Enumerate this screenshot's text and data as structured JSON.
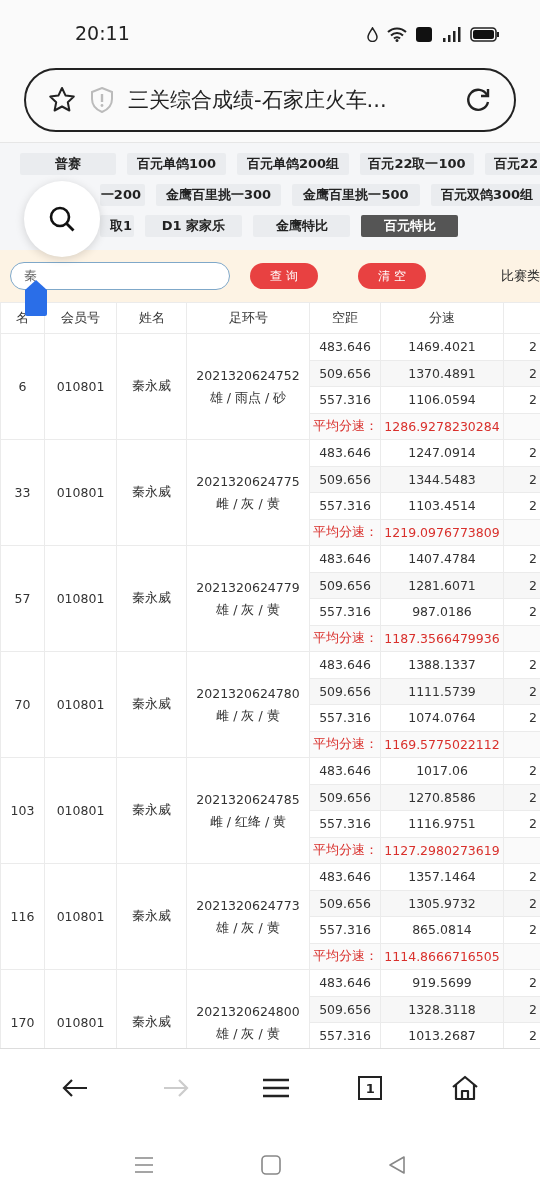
{
  "status_bar": {
    "time": "20:11"
  },
  "address_bar": {
    "title": "三关综合成绩-石家庄火车..."
  },
  "race_filters": {
    "rows": [
      [
        {
          "label": "普赛",
          "selected": false
        },
        {
          "label": "百元单鸽100",
          "selected": false
        },
        {
          "label": "百元单鸽200组",
          "selected": false
        },
        {
          "label": "百元22取一100",
          "selected": false
        },
        {
          "label": "百元22",
          "selected": false
        }
      ],
      [
        {
          "label": "一200",
          "selected": false
        },
        {
          "label": "金鹰百里挑一300",
          "selected": false
        },
        {
          "label": "金鹰百里挑一500",
          "selected": false
        },
        {
          "label": "百元双鸽300组",
          "selected": false
        }
      ],
      [
        {
          "label": "取1",
          "selected": false
        },
        {
          "label": "D1 家家乐",
          "selected": false
        },
        {
          "label": "金鹰特比",
          "selected": false
        },
        {
          "label": "百元特比",
          "selected": true
        }
      ]
    ]
  },
  "search": {
    "value": "秦",
    "buttons": [
      "查 询",
      "清 空"
    ],
    "type_label": "比赛类"
  },
  "table": {
    "columns": [
      "名",
      "会员号",
      "姓名",
      "足环号",
      "空距",
      "分速"
    ],
    "groups": [
      {
        "rank": "6",
        "member_id": "010801",
        "name": "秦永威",
        "ring": "2021320624752",
        "description": "雄 / 雨点 / 砂",
        "legs": [
          {
            "distance": "483.646",
            "speed": "1469.4021",
            "column_7": "2"
          },
          {
            "distance": "509.656",
            "speed": "1370.4891",
            "column_7": "2"
          },
          {
            "distance": "557.316",
            "speed": "1106.0594",
            "column_7": "2"
          }
        ],
        "average": {
          "label": "平均分速：",
          "value": "1286.9278230284"
        }
      },
      {
        "rank": "33",
        "member_id": "010801",
        "name": "秦永威",
        "ring": "2021320624775",
        "description": "雌 / 灰 / 黄",
        "legs": [
          {
            "distance": "483.646",
            "speed": "1247.0914",
            "column_7": "2"
          },
          {
            "distance": "509.656",
            "speed": "1344.5483",
            "column_7": "2"
          },
          {
            "distance": "557.316",
            "speed": "1103.4514",
            "column_7": "2"
          }
        ],
        "average": {
          "label": "平均分速：",
          "value": "1219.0976773809"
        }
      },
      {
        "rank": "57",
        "member_id": "010801",
        "name": "秦永威",
        "ring": "2021320624779",
        "description": "雄 / 灰 / 黄",
        "legs": [
          {
            "distance": "483.646",
            "speed": "1407.4784",
            "column_7": "2"
          },
          {
            "distance": "509.656",
            "speed": "1281.6071",
            "column_7": "2"
          },
          {
            "distance": "557.316",
            "speed": "987.0186",
            "column_7": "2"
          }
        ],
        "average": {
          "label": "平均分速：",
          "value": "1187.3566479936"
        }
      },
      {
        "rank": "70",
        "member_id": "010801",
        "name": "秦永威",
        "ring": "2021320624780",
        "description": "雌 / 灰 / 黄",
        "legs": [
          {
            "distance": "483.646",
            "speed": "1388.1337",
            "column_7": "2"
          },
          {
            "distance": "509.656",
            "speed": "1111.5739",
            "column_7": "2"
          },
          {
            "distance": "557.316",
            "speed": "1074.0764",
            "column_7": "2"
          }
        ],
        "average": {
          "label": "平均分速：",
          "value": "1169.5775022112"
        }
      },
      {
        "rank": "103",
        "member_id": "010801",
        "name": "秦永威",
        "ring": "2021320624785",
        "description": "雌 / 红绛 / 黄",
        "legs": [
          {
            "distance": "483.646",
            "speed": "1017.06",
            "column_7": "2"
          },
          {
            "distance": "509.656",
            "speed": "1270.8586",
            "column_7": "2"
          },
          {
            "distance": "557.316",
            "speed": "1116.9751",
            "column_7": "2"
          }
        ],
        "average": {
          "label": "平均分速：",
          "value": "1127.2980273619"
        }
      },
      {
        "rank": "116",
        "member_id": "010801",
        "name": "秦永威",
        "ring": "2021320624773",
        "description": "雄 / 灰 / 黄",
        "legs": [
          {
            "distance": "483.646",
            "speed": "1357.1464",
            "column_7": "2"
          },
          {
            "distance": "509.656",
            "speed": "1305.9732",
            "column_7": "2"
          },
          {
            "distance": "557.316",
            "speed": "865.0814",
            "column_7": "2"
          }
        ],
        "average": {
          "label": "平均分速：",
          "value": "1114.8666716505"
        }
      },
      {
        "rank": "170",
        "member_id": "010801",
        "name": "秦永威",
        "ring": "2021320624800",
        "description": "雄 / 灰 / 黄",
        "legs": [
          {
            "distance": "483.646",
            "speed": "919.5699",
            "column_7": "2"
          },
          {
            "distance": "509.656",
            "speed": "1328.3118",
            "column_7": "2"
          },
          {
            "distance": "557.316",
            "speed": "1013.2687",
            "column_7": "2"
          }
        ]
      }
    ]
  },
  "browser_toolbar": {
    "buttons": [
      {
        "kind": "back",
        "disabled": false
      },
      {
        "kind": "forward",
        "disabled": true
      },
      {
        "kind": "menu",
        "disabled": false
      },
      {
        "kind": "tabs",
        "label": "1",
        "disabled": false
      },
      {
        "kind": "home",
        "disabled": false
      }
    ]
  }
}
